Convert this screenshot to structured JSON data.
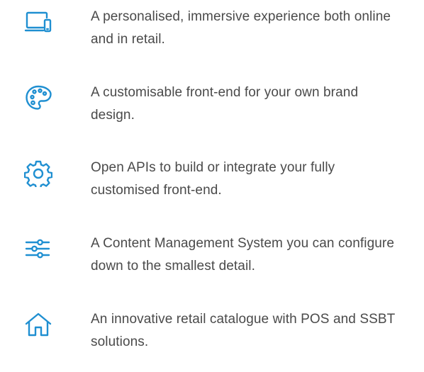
{
  "features": [
    {
      "icon": "devices-icon",
      "text": "A personalised, immersive experience both online and in retail."
    },
    {
      "icon": "palette-icon",
      "text": "A customisable front-end for your own brand design."
    },
    {
      "icon": "gear-icon",
      "text": "Open APIs to build or integrate your fully customised front-end."
    },
    {
      "icon": "sliders-icon",
      "text": "A Content Management System you can configure down to the smallest detail."
    },
    {
      "icon": "home-icon",
      "text": "An innovative retail catalogue with POS and SSBT solutions."
    }
  ],
  "colors": {
    "icon": "#1f8fd1",
    "text": "#4a4a4a",
    "background": "#ffffff"
  }
}
